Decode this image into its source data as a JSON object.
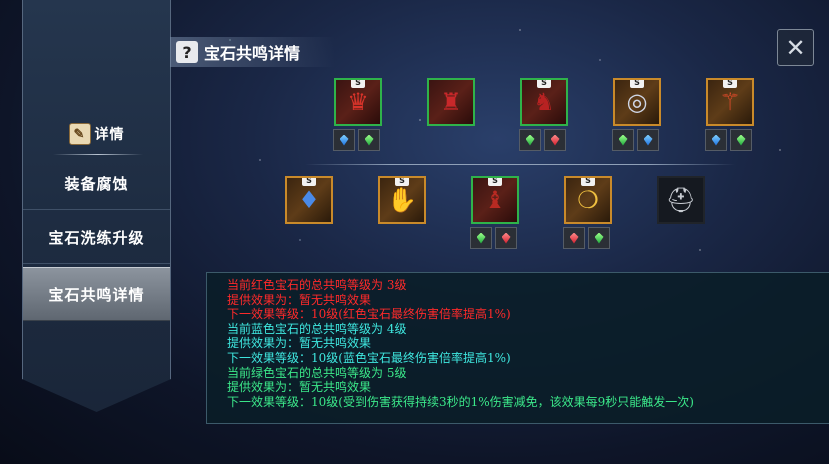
{
  "sidebar": {
    "detail_label": "详情",
    "items": [
      {
        "label": "装备腐蚀"
      },
      {
        "label": "宝石洗练升级"
      },
      {
        "label": "宝石共鸣详情"
      }
    ]
  },
  "header": {
    "title": "宝石共鸣详情",
    "help_glyph": "?"
  },
  "close": {
    "glyph": "✕"
  },
  "equipment": {
    "badge": "S",
    "row1": [
      {
        "icon": "red-helmet-icon",
        "gems": [
          "blue",
          "green"
        ]
      },
      {
        "icon": "red-armor-icon",
        "gems": []
      },
      {
        "icon": "red-robe-icon",
        "gems": [
          "green",
          "red"
        ]
      },
      {
        "icon": "silver-ring-icon",
        "gems": [
          "green",
          "blue"
        ]
      },
      {
        "icon": "scepter-icon",
        "gems": [
          "blue",
          "green"
        ]
      }
    ],
    "row2": [
      {
        "icon": "necklace-icon",
        "gems": []
      },
      {
        "icon": "gauntlet-icon",
        "gems": []
      },
      {
        "icon": "red-boots-icon",
        "gems": [
          "green",
          "red"
        ]
      },
      {
        "icon": "gold-ring-icon",
        "gems": [
          "red",
          "green"
        ]
      },
      {
        "icon": "locked-helmet-icon",
        "gems": []
      }
    ]
  },
  "info": {
    "lines": [
      {
        "text": "当前红色宝石的总共鸣等级为 3级",
        "color": "#ff2a2a"
      },
      {
        "text": "提供效果为：暂无共鸣效果",
        "color": "#ff2a2a"
      },
      {
        "text": "下一效果等级：10级(红色宝石最终伤害倍率提高1%)",
        "color": "#ff2a2a"
      },
      {
        "text": "当前蓝色宝石的总共鸣等级为 4级",
        "color": "#3fe8e0"
      },
      {
        "text": "提供效果为：暂无共鸣效果",
        "color": "#3fe8e0"
      },
      {
        "text": "下一效果等级：10级(蓝色宝石最终伤害倍率提高1%)",
        "color": "#3fe8e0"
      },
      {
        "text": "当前绿色宝石的总共鸣等级为 5级",
        "color": "#3be88a"
      },
      {
        "text": "提供效果为：暂无共鸣效果",
        "color": "#3be88a"
      },
      {
        "text": "下一效果等级：10级(受到伤害获得持续3秒的1%伤害减免，该效果每9秒只能触发一次)",
        "color": "#3be88a"
      }
    ]
  }
}
